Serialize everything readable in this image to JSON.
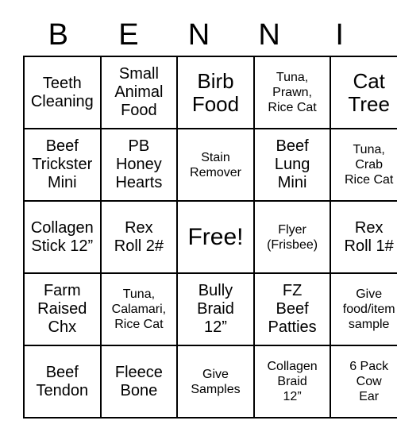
{
  "card": {
    "title_letters": [
      "B",
      "E",
      "N",
      "N",
      "I"
    ],
    "columns": 5,
    "rows": 5,
    "border_color": "#000000",
    "background_color": "#ffffff",
    "text_color": "#000000",
    "free_space": {
      "row": 3,
      "column": 3,
      "label": "Free!"
    },
    "cells": [
      [
        {
          "label": "Teeth\nCleaning",
          "size": "md"
        },
        {
          "label": "Small\nAnimal\nFood",
          "size": "md"
        },
        {
          "label": "Birb\nFood",
          "size": "lg"
        },
        {
          "label": "Tuna,\nPrawn,\nRice Cat",
          "size": "sm"
        },
        {
          "label": "Cat\nTree",
          "size": "lg"
        }
      ],
      [
        {
          "label": "Beef\nTrickster\nMini",
          "size": "md"
        },
        {
          "label": "PB\nHoney\nHearts",
          "size": "md"
        },
        {
          "label": "Stain\nRemover",
          "size": "sm"
        },
        {
          "label": "Beef\nLung\nMini",
          "size": "md"
        },
        {
          "label": "Tuna,\nCrab\nRice Cat",
          "size": "sm"
        }
      ],
      [
        {
          "label": "Collagen\nStick 12”",
          "size": "md"
        },
        {
          "label": "Rex\nRoll 2#",
          "size": "md"
        },
        {
          "label": "Free!",
          "size": "xl"
        },
        {
          "label": "Flyer\n(Frisbee)",
          "size": "sm"
        },
        {
          "label": "Rex\nRoll 1#",
          "size": "md"
        }
      ],
      [
        {
          "label": "Farm\nRaised\nChx",
          "size": "md"
        },
        {
          "label": "Tuna,\nCalamari,\nRice Cat",
          "size": "sm"
        },
        {
          "label": "Bully\nBraid\n12”",
          "size": "md"
        },
        {
          "label": "FZ\nBeef\nPatties",
          "size": "md"
        },
        {
          "label": "Give\nfood/item\nsample",
          "size": "sm"
        }
      ],
      [
        {
          "label": "Beef\nTendon",
          "size": "md"
        },
        {
          "label": "Fleece\nBone",
          "size": "md"
        },
        {
          "label": "Give\nSamples",
          "size": "sm"
        },
        {
          "label": "Collagen\nBraid\n12”",
          "size": "sm"
        },
        {
          "label": "6 Pack\nCow\nEar",
          "size": "sm"
        }
      ]
    ]
  }
}
